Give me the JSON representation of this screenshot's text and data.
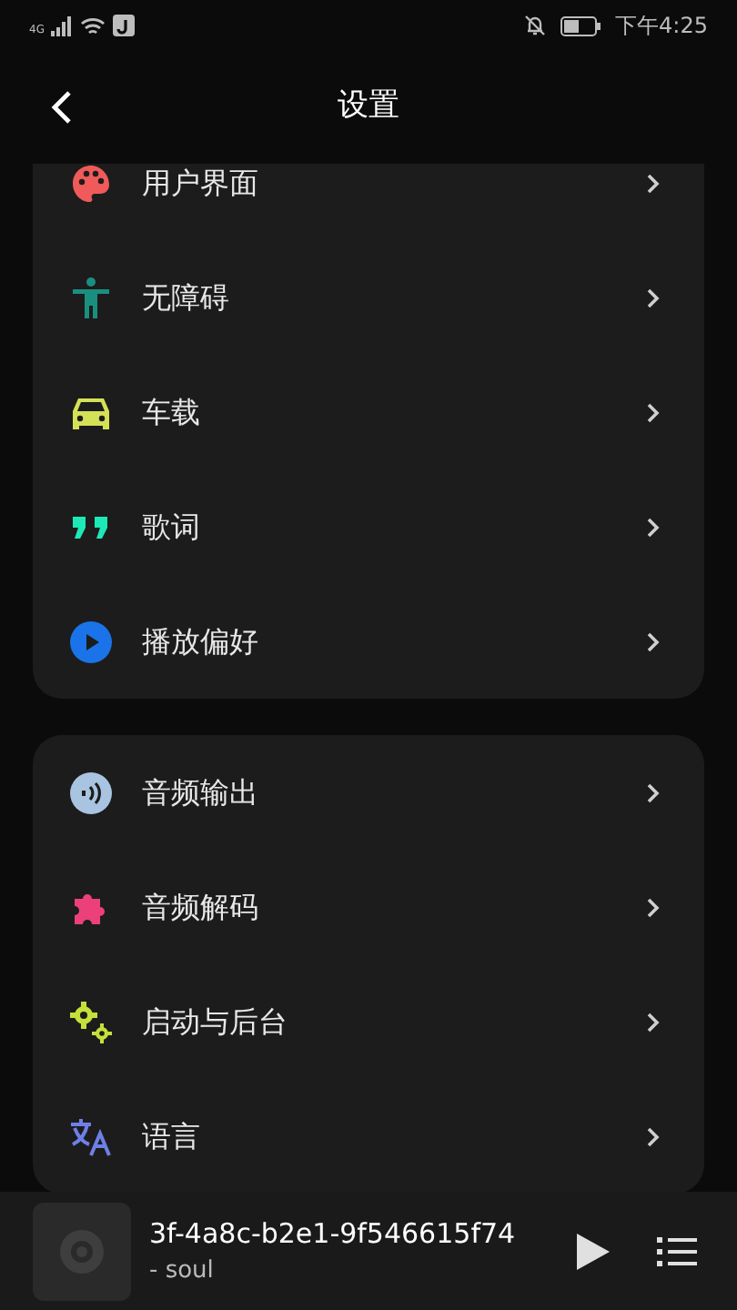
{
  "status_bar": {
    "network": "4G",
    "time": "下午4:25"
  },
  "header": {
    "title": "设置"
  },
  "groups": [
    {
      "items": [
        {
          "label": "用户界面"
        },
        {
          "label": "无障碍"
        },
        {
          "label": "车载"
        },
        {
          "label": "歌词"
        },
        {
          "label": "播放偏好"
        }
      ]
    },
    {
      "items": [
        {
          "label": "音频输出"
        },
        {
          "label": "音频解码"
        },
        {
          "label": "启动与后台"
        },
        {
          "label": "语言"
        }
      ]
    }
  ],
  "mini_player": {
    "title": "3f-4a8c-b2e1-9f546615f74",
    "subtitle": "- soul"
  }
}
